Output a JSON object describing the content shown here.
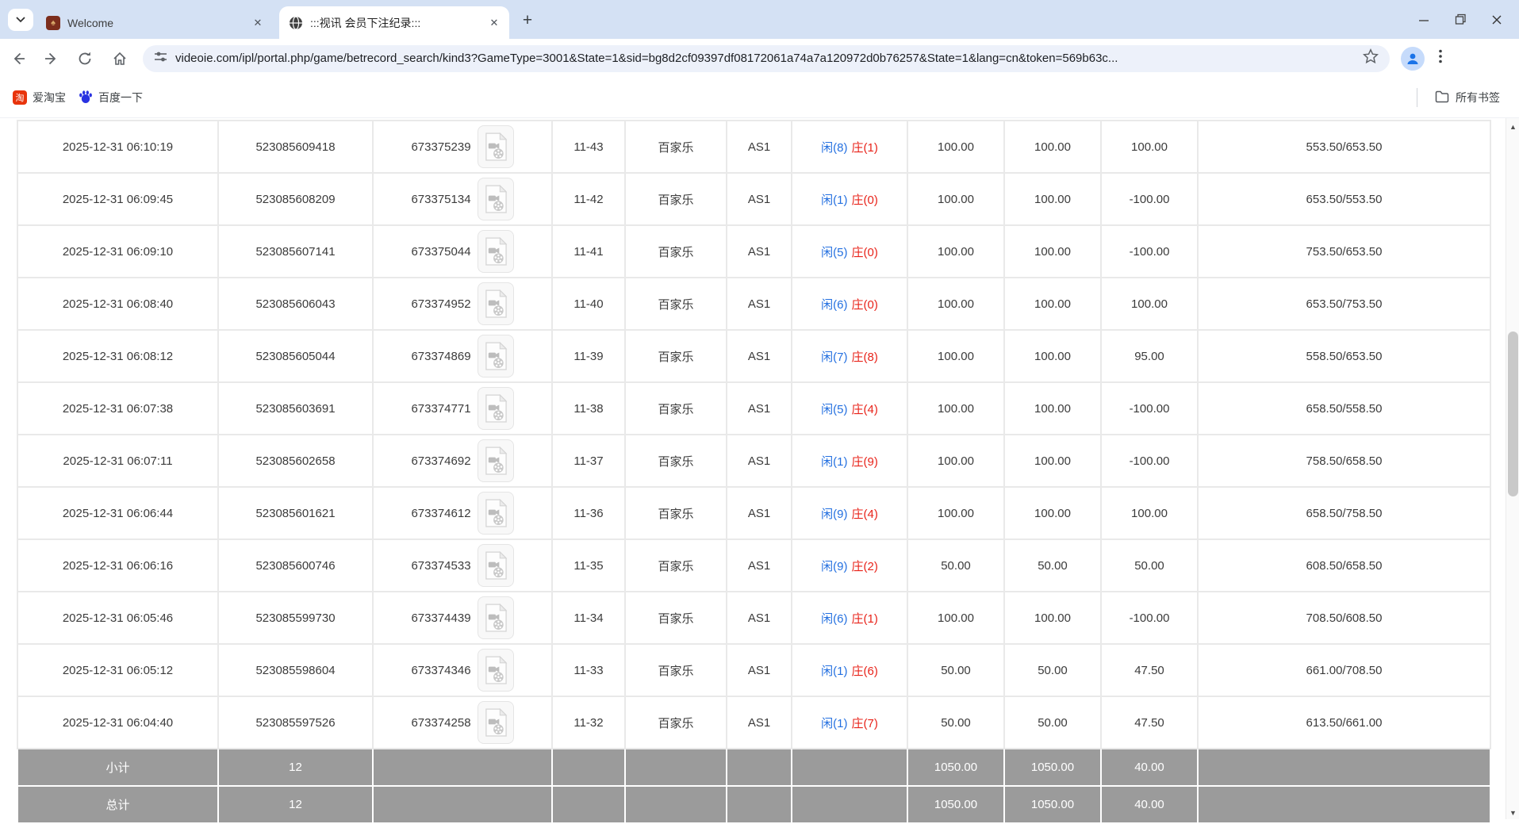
{
  "browser": {
    "tabs": [
      {
        "title": "Welcome",
        "favicon": "casino-spade-favicon",
        "close": "✕"
      },
      {
        "title": ":::视讯 会员下注纪录:::",
        "favicon": "globe-favicon",
        "close": "✕"
      }
    ],
    "new_tab_label": "+"
  },
  "toolbar": {
    "url": "videoie.com/ipl/portal.php/game/betrecord_search/kind3?GameType=3001&State=1&sid=bg8d2cf09397df08172061a74a7a120972d0b76257&State=1&lang=cn&token=569b63c..."
  },
  "bookmarks_bar": {
    "items": [
      {
        "label": "爱淘宝",
        "icon": "taobao-icon"
      },
      {
        "label": "百度一下",
        "icon": "baidu-paw-icon"
      }
    ],
    "all_bookmarks_label": "所有书签"
  },
  "colors": {
    "tabstrip_bg": "#d4e1f4",
    "link_blue": "#2470e0",
    "banker_red": "#e8231a",
    "negative_red": "#f00f0f",
    "footer_gray": "#9b9b9b"
  },
  "table": {
    "rows": [
      {
        "time": "2025-12-31 06:10:19",
        "bet_id": "523085609418",
        "round_id": "673375239",
        "table_round": "11-43",
        "game": "百家乐",
        "table_code": "AS1",
        "result_player": "闲(8)",
        "result_banker": "庄(1)",
        "bet_amount": "100.00",
        "valid_amount": "100.00",
        "win_loss": "100.00",
        "balance": "553.50/653.50"
      },
      {
        "time": "2025-12-31 06:09:45",
        "bet_id": "523085608209",
        "round_id": "673375134",
        "table_round": "11-42",
        "game": "百家乐",
        "table_code": "AS1",
        "result_player": "闲(1)",
        "result_banker": "庄(0)",
        "bet_amount": "100.00",
        "valid_amount": "100.00",
        "win_loss": "-100.00",
        "balance": "653.50/553.50"
      },
      {
        "time": "2025-12-31 06:09:10",
        "bet_id": "523085607141",
        "round_id": "673375044",
        "table_round": "11-41",
        "game": "百家乐",
        "table_code": "AS1",
        "result_player": "闲(5)",
        "result_banker": "庄(0)",
        "bet_amount": "100.00",
        "valid_amount": "100.00",
        "win_loss": "-100.00",
        "balance": "753.50/653.50"
      },
      {
        "time": "2025-12-31 06:08:40",
        "bet_id": "523085606043",
        "round_id": "673374952",
        "table_round": "11-40",
        "game": "百家乐",
        "table_code": "AS1",
        "result_player": "闲(6)",
        "result_banker": "庄(0)",
        "bet_amount": "100.00",
        "valid_amount": "100.00",
        "win_loss": "100.00",
        "balance": "653.50/753.50"
      },
      {
        "time": "2025-12-31 06:08:12",
        "bet_id": "523085605044",
        "round_id": "673374869",
        "table_round": "11-39",
        "game": "百家乐",
        "table_code": "AS1",
        "result_player": "闲(7)",
        "result_banker": "庄(8)",
        "bet_amount": "100.00",
        "valid_amount": "100.00",
        "win_loss": "95.00",
        "balance": "558.50/653.50"
      },
      {
        "time": "2025-12-31 06:07:38",
        "bet_id": "523085603691",
        "round_id": "673374771",
        "table_round": "11-38",
        "game": "百家乐",
        "table_code": "AS1",
        "result_player": "闲(5)",
        "result_banker": "庄(4)",
        "bet_amount": "100.00",
        "valid_amount": "100.00",
        "win_loss": "-100.00",
        "balance": "658.50/558.50"
      },
      {
        "time": "2025-12-31 06:07:11",
        "bet_id": "523085602658",
        "round_id": "673374692",
        "table_round": "11-37",
        "game": "百家乐",
        "table_code": "AS1",
        "result_player": "闲(1)",
        "result_banker": "庄(9)",
        "bet_amount": "100.00",
        "valid_amount": "100.00",
        "win_loss": "-100.00",
        "balance": "758.50/658.50"
      },
      {
        "time": "2025-12-31 06:06:44",
        "bet_id": "523085601621",
        "round_id": "673374612",
        "table_round": "11-36",
        "game": "百家乐",
        "table_code": "AS1",
        "result_player": "闲(9)",
        "result_banker": "庄(4)",
        "bet_amount": "100.00",
        "valid_amount": "100.00",
        "win_loss": "100.00",
        "balance": "658.50/758.50"
      },
      {
        "time": "2025-12-31 06:06:16",
        "bet_id": "523085600746",
        "round_id": "673374533",
        "table_round": "11-35",
        "game": "百家乐",
        "table_code": "AS1",
        "result_player": "闲(9)",
        "result_banker": "庄(2)",
        "bet_amount": "50.00",
        "valid_amount": "50.00",
        "win_loss": "50.00",
        "balance": "608.50/658.50"
      },
      {
        "time": "2025-12-31 06:05:46",
        "bet_id": "523085599730",
        "round_id": "673374439",
        "table_round": "11-34",
        "game": "百家乐",
        "table_code": "AS1",
        "result_player": "闲(6)",
        "result_banker": "庄(1)",
        "bet_amount": "100.00",
        "valid_amount": "100.00",
        "win_loss": "-100.00",
        "balance": "708.50/608.50"
      },
      {
        "time": "2025-12-31 06:05:12",
        "bet_id": "523085598604",
        "round_id": "673374346",
        "table_round": "11-33",
        "game": "百家乐",
        "table_code": "AS1",
        "result_player": "闲(1)",
        "result_banker": "庄(6)",
        "bet_amount": "50.00",
        "valid_amount": "50.00",
        "win_loss": "47.50",
        "balance": "661.00/708.50"
      },
      {
        "time": "2025-12-31 06:04:40",
        "bet_id": "523085597526",
        "round_id": "673374258",
        "table_round": "11-32",
        "game": "百家乐",
        "table_code": "AS1",
        "result_player": "闲(1)",
        "result_banker": "庄(7)",
        "bet_amount": "50.00",
        "valid_amount": "50.00",
        "win_loss": "47.50",
        "balance": "613.50/661.00"
      }
    ],
    "subtotal": {
      "label": "小计",
      "count": "12",
      "bet_total": "1050.00",
      "valid_total": "1050.00",
      "win_loss_total": "40.00"
    },
    "total": {
      "label": "总计",
      "count": "12",
      "bet_total": "1050.00",
      "valid_total": "1050.00",
      "win_loss_total": "40.00"
    }
  }
}
